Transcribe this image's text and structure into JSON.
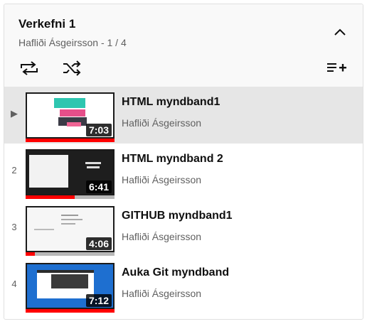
{
  "playlist": {
    "title": "Verkefni 1",
    "subtitle": "Hafliði Ásgeirsson - 1 / 4"
  },
  "icons": {
    "collapse": "chevron-up-icon",
    "loop": "loop-icon",
    "shuffle": "shuffle-icon",
    "save": "playlist-add-icon",
    "now_playing": "play-indicator-icon"
  },
  "colors": {
    "progress": "#ff0000",
    "active_row": "#e6e6e6",
    "header_bg": "#f9f9f9"
  },
  "videos": [
    {
      "index": "▶",
      "title": "HTML myndband1",
      "channel": "Hafliði Ásgeirsson",
      "duration": "7:03",
      "progress": 1.0,
      "active": true
    },
    {
      "index": "2",
      "title": "HTML myndband 2",
      "channel": "Hafliði Ásgeirsson",
      "duration": "6:41",
      "progress": 0.55,
      "active": false
    },
    {
      "index": "3",
      "title": "GITHUB myndband1",
      "channel": "Hafliði Ásgeirsson",
      "duration": "4:06",
      "progress": 0.1,
      "active": false
    },
    {
      "index": "4",
      "title": "Auka Git myndband",
      "channel": "Hafliði Ásgeirsson",
      "duration": "7:12",
      "progress": 1.0,
      "active": false
    }
  ]
}
